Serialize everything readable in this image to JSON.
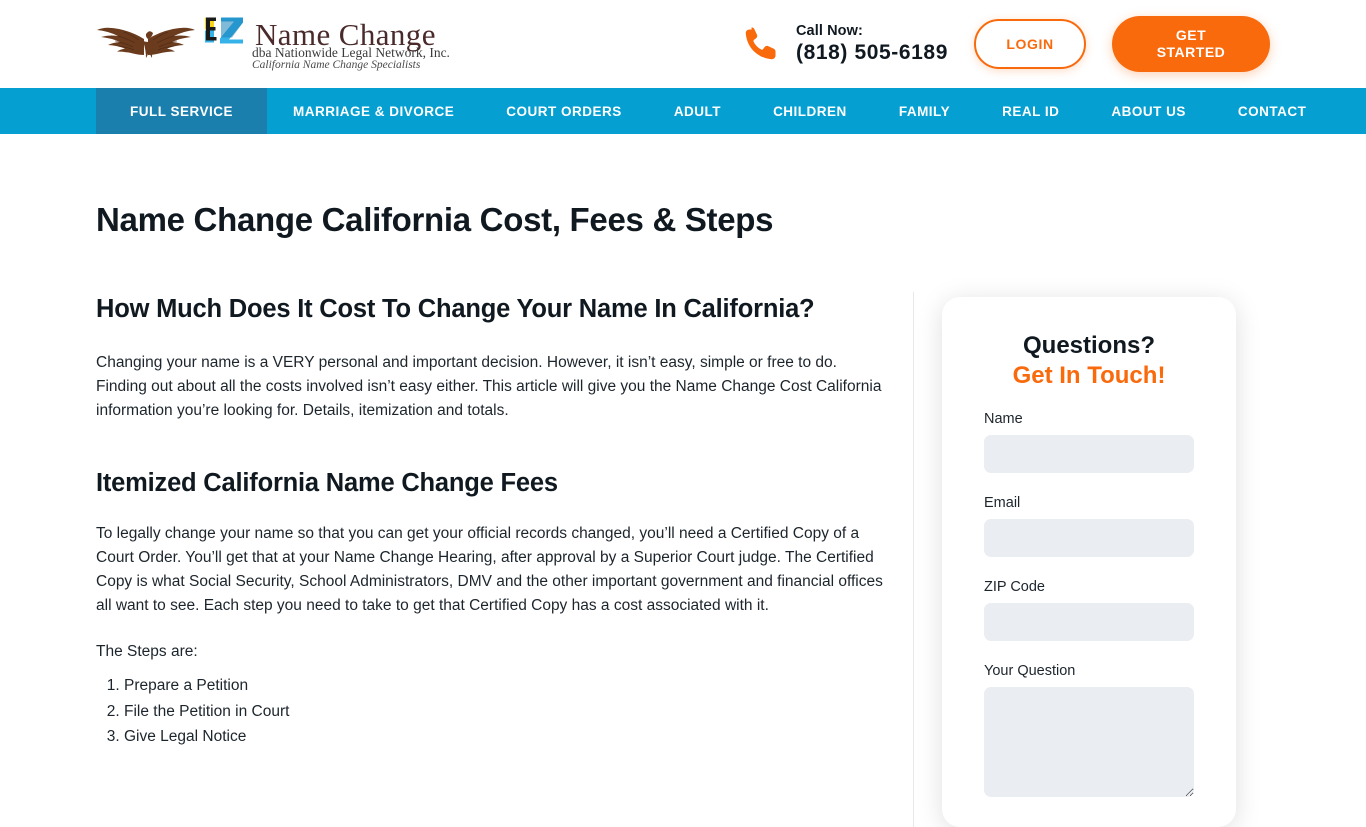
{
  "header": {
    "logo": {
      "eagle_icon": "eagle-icon",
      "ez_mark": "ez-monogram-icon",
      "brand": "Name Change",
      "sub1": "dba Nationwide Legal Network, Inc.",
      "sub2": "California Name Change Specialists"
    },
    "phone_icon": "phone-icon",
    "call_label": "Call Now:",
    "call_number": "(818) 505-6189",
    "login_label": "LOGIN",
    "get_started_label": "GET\nSTARTED",
    "get_started_line1": "GET",
    "get_started_line2": "STARTED"
  },
  "nav": {
    "items": [
      {
        "label": "FULL SERVICE",
        "active": true
      },
      {
        "label": "MARRIAGE & DIVORCE",
        "active": false
      },
      {
        "label": "COURT ORDERS",
        "active": false
      },
      {
        "label": "ADULT",
        "active": false
      },
      {
        "label": "CHILDREN",
        "active": false
      },
      {
        "label": "FAMILY",
        "active": false
      },
      {
        "label": "REAL ID",
        "active": false
      },
      {
        "label": "ABOUT US",
        "active": false
      },
      {
        "label": "CONTACT",
        "active": false
      }
    ]
  },
  "main": {
    "page_title": "Name Change California Cost, Fees & Steps",
    "section1_heading": "How Much Does It Cost To Change Your Name In California?",
    "section1_paragraph": "Changing your name is a VERY personal and important decision. However, it isn’t easy, simple or free to do. Finding out about all the costs involved isn’t easy either. This article will give you the Name Change Cost California information you’re looking for. Details, itemization and totals.",
    "section2_heading": "Itemized California Name Change Fees",
    "section2_paragraph": "To legally change your name so that you can get your official records changed, you’ll need a Certified Copy of a Court Order. You’ll get that at your Name Change Hearing, after approval by a Superior Court judge. The Certified Copy is what Social Security, School Administrators, DMV and the other important government and financial offices all want to see. Each step you need to take to get that Certified Copy has a cost associated with it.",
    "steps_intro": "The Steps are:",
    "steps": [
      "Prepare a Petition",
      "File the Petition in Court",
      "Give Legal Notice"
    ]
  },
  "sidebar": {
    "card_title_line1": "Questions?",
    "card_title_line2": "Get In Touch!",
    "fields": [
      {
        "label": "Name",
        "value": "",
        "placeholder": ""
      },
      {
        "label": "Email",
        "value": "",
        "placeholder": ""
      },
      {
        "label": "ZIP Code",
        "value": "",
        "placeholder": ""
      },
      {
        "label": "Your Question",
        "value": "",
        "placeholder": ""
      }
    ]
  },
  "colors": {
    "nav_blue": "#05a0d1",
    "nav_active_blue": "#1b7fae",
    "orange": "#f96a0d",
    "input_fill": "#eaeef2",
    "text": "#101820"
  }
}
